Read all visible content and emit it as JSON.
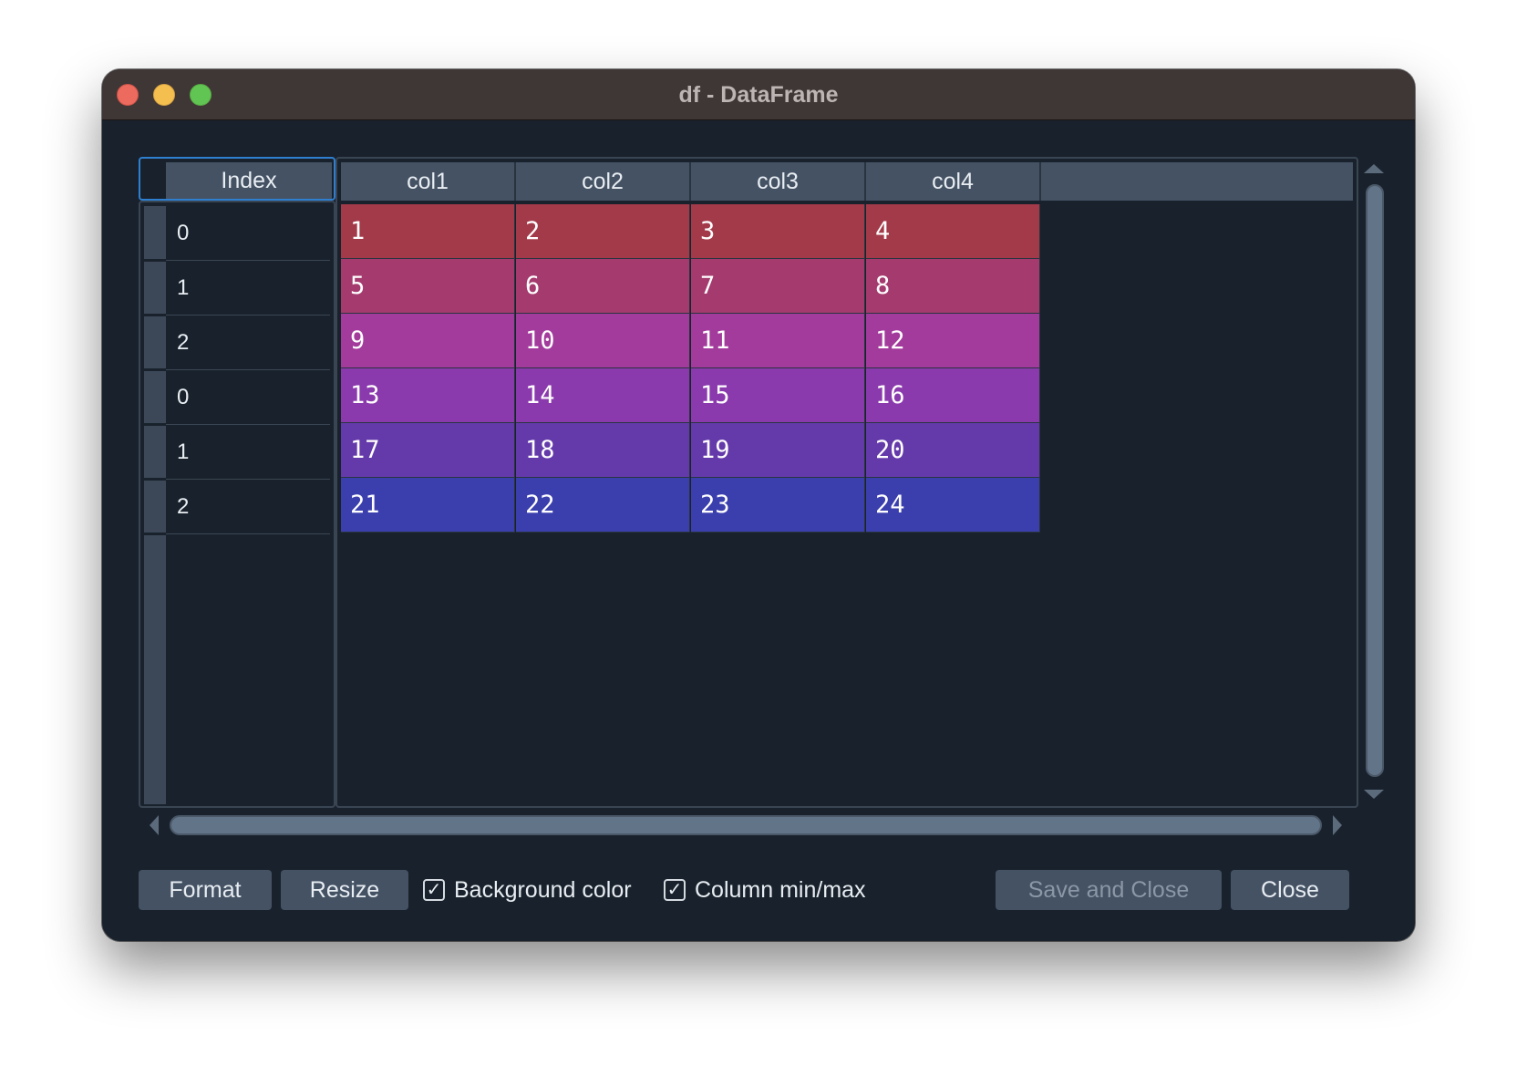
{
  "window": {
    "title": "df - DataFrame"
  },
  "index": {
    "header": "Index",
    "rows": [
      "0",
      "1",
      "2",
      "0",
      "1",
      "2"
    ]
  },
  "columns": [
    "col1",
    "col2",
    "col3",
    "col4"
  ],
  "rows": [
    [
      "1",
      "2",
      "3",
      "4"
    ],
    [
      "5",
      "6",
      "7",
      "8"
    ],
    [
      "9",
      "10",
      "11",
      "12"
    ],
    [
      "13",
      "14",
      "15",
      "16"
    ],
    [
      "17",
      "18",
      "19",
      "20"
    ],
    [
      "21",
      "22",
      "23",
      "24"
    ]
  ],
  "row_colors": [
    "#a33a49",
    "#a43a6e",
    "#a23b9b",
    "#8a3aac",
    "#643aaa",
    "#3b3fad"
  ],
  "toolbar": {
    "format_label": "Format",
    "resize_label": "Resize",
    "background_color": {
      "label": "Background color",
      "checked": true
    },
    "column_minmax": {
      "label": "Column min/max",
      "checked": true
    },
    "save_close_label": "Save and Close",
    "close_label": "Close"
  }
}
